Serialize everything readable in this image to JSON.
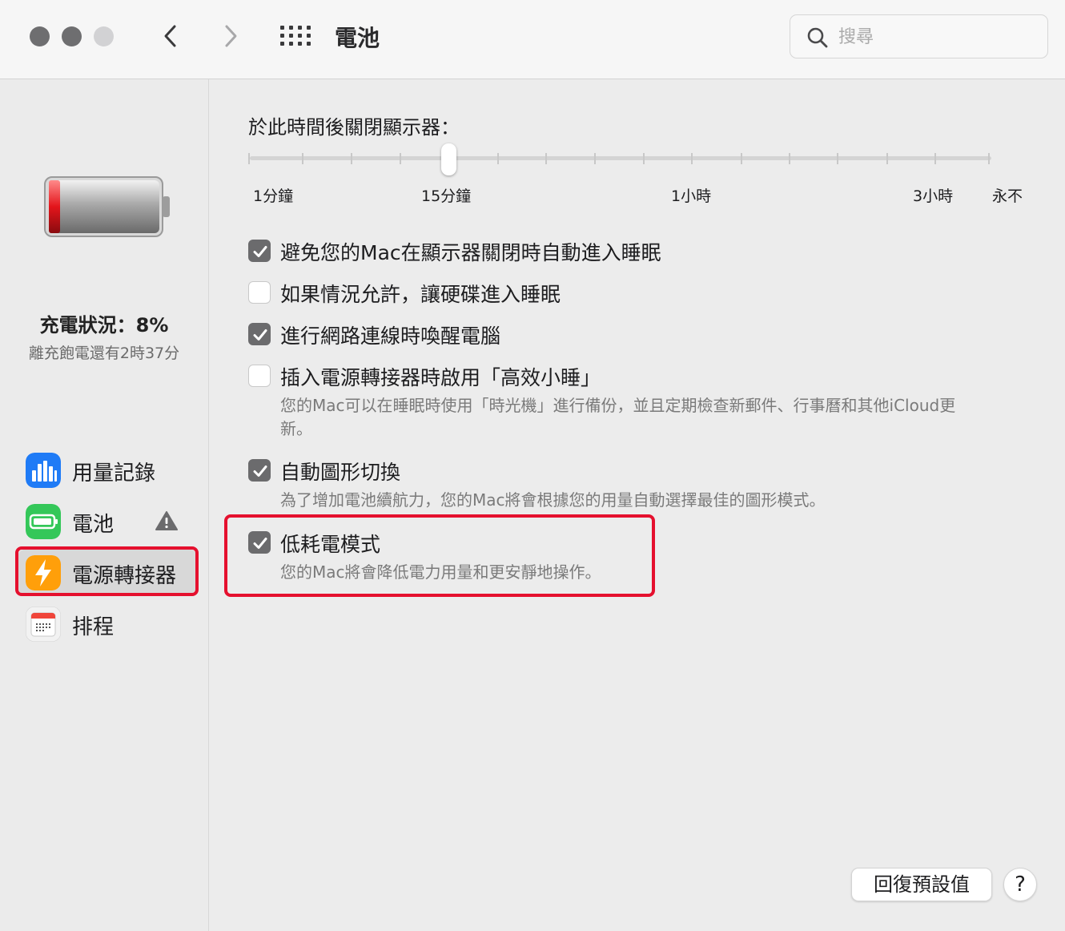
{
  "window": {
    "title": "電池",
    "search_placeholder": "搜尋"
  },
  "sidebar": {
    "charge_status": "充電狀況：8%",
    "charge_remaining": "離充飽電還有2時37分",
    "items": [
      {
        "label": "用量記錄",
        "icon": "usage-history-icon",
        "color": "#1f7bf6"
      },
      {
        "label": "電池",
        "icon": "battery-icon",
        "color": "#34c759",
        "warning": true
      },
      {
        "label": "電源轉接器",
        "icon": "power-adapter-icon",
        "color": "#ff9f0a",
        "selected": true
      },
      {
        "label": "排程",
        "icon": "calendar-icon",
        "color": "#f2f2f2"
      }
    ]
  },
  "display_off": {
    "title": "於此時間後關閉顯示器：",
    "tick_count": 16,
    "selected_tick": 4,
    "labels": [
      "1分鐘",
      "15分鐘",
      "1小時",
      "3小時",
      "永不"
    ]
  },
  "options": [
    {
      "label": "避免您的Mac在顯示器關閉時自動進入睡眠",
      "checked": true
    },
    {
      "label": "如果情況允許，讓硬碟進入睡眠",
      "checked": false
    },
    {
      "label": "進行網路連線時喚醒電腦",
      "checked": true
    },
    {
      "label": "插入電源轉接器時啟用「高效小睡」",
      "checked": false,
      "desc": "您的Mac可以在睡眠時使用「時光機」進行備份，並且定期檢查新郵件、行事曆和其他iCloud更新。"
    },
    {
      "label": "自動圖形切換",
      "checked": true,
      "desc": "為了增加電池續航力，您的Mac將會根據您的用量自動選擇最佳的圖形模式。"
    },
    {
      "label": "低耗電模式",
      "checked": true,
      "desc": "您的Mac將會降低電力用量和更安靜地操作。"
    }
  ],
  "buttons": {
    "restore_defaults": "回復預設值",
    "help": "?"
  },
  "colors": {
    "highlight": "#e5102e",
    "checkbox_checked": "#6b6b6d"
  }
}
